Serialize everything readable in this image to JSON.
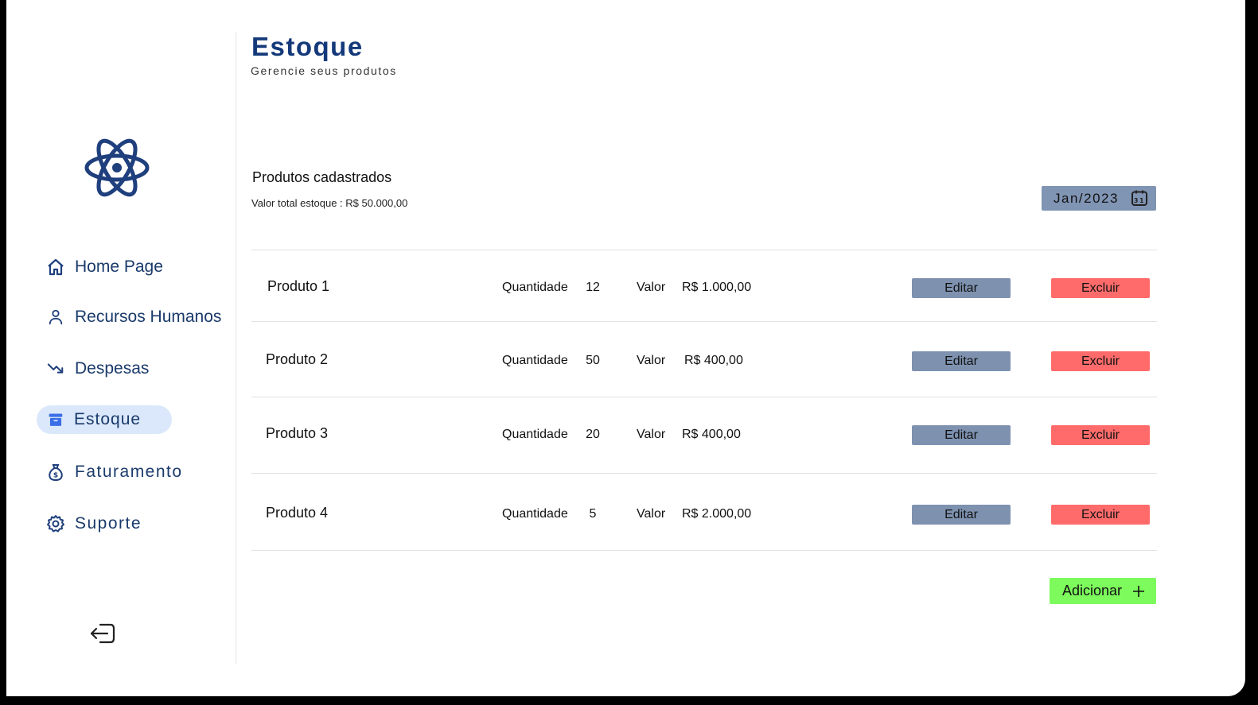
{
  "header": {
    "title": "Estoque",
    "subtitle": "Gerencie seus produtos"
  },
  "sidebar": {
    "items": [
      {
        "label": "Home Page",
        "icon": "home-icon"
      },
      {
        "label": "Recursos Humanos",
        "icon": "user-icon"
      },
      {
        "label": "Despesas",
        "icon": "trending-down-icon"
      },
      {
        "label": "Estoque",
        "icon": "archive-icon",
        "active": true
      },
      {
        "label": "Faturamento",
        "icon": "money-bag-icon"
      },
      {
        "label": "Suporte",
        "icon": "gear-icon"
      }
    ],
    "logout_icon": "logout-icon"
  },
  "main": {
    "section_title": "Produtos cadastrados",
    "total_value": "Valor total estoque : R$ 50.000,00",
    "date_filter": "Jan/2023",
    "products": [
      {
        "name": "Produto 1",
        "qty_label": "Quantidade",
        "qty": "12",
        "value_label": "Valor",
        "value": "R$ 1.000,00",
        "edit": "Editar",
        "delete": "Excluir"
      },
      {
        "name": "Produto 2",
        "qty_label": "Quantidade",
        "qty": "50",
        "value_label": "Valor",
        "value": "R$ 400,00",
        "edit": "Editar",
        "delete": "Excluir"
      },
      {
        "name": "Produto 3",
        "qty_label": "Quantidade",
        "qty": "20",
        "value_label": "Valor",
        "value": "R$ 400,00",
        "edit": "Editar",
        "delete": "Excluir"
      },
      {
        "name": "Produto 4",
        "qty_label": "Quantidade",
        "qty": "5",
        "value_label": "Valor",
        "value": "R$ 2.000,00",
        "edit": "Editar",
        "delete": "Excluir"
      }
    ],
    "add_button": "Adicionar"
  },
  "colors": {
    "primary": "#14397a",
    "nav_active_bg": "#dbe8fb",
    "edit_button": "#7e92b0",
    "delete_button": "#ff6b6b",
    "add_button": "#7dfa5c",
    "date_button": "#8094b3"
  }
}
